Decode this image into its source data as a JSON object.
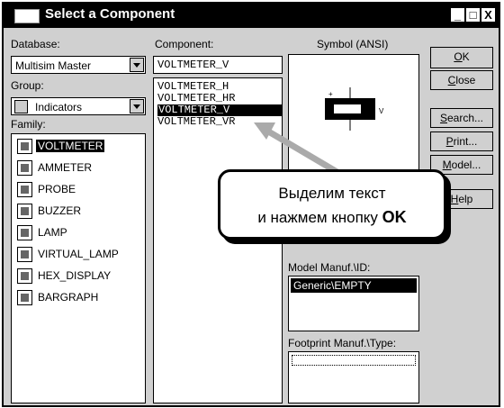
{
  "window": {
    "title": "Select a Component",
    "minimize_glyph": "_",
    "maximize_glyph": "□",
    "close_glyph": "X"
  },
  "database": {
    "label": "Database:",
    "value": "Multisim Master"
  },
  "group": {
    "label": "Group:",
    "value": "Indicators"
  },
  "family": {
    "label": "Family:",
    "items": [
      {
        "label": "VOLTMETER",
        "icon": "voltmeter-icon",
        "selected": true
      },
      {
        "label": "AMMETER",
        "icon": "ammeter-icon"
      },
      {
        "label": "PROBE",
        "icon": "probe-icon"
      },
      {
        "label": "BUZZER",
        "icon": "buzzer-icon"
      },
      {
        "label": "LAMP",
        "icon": "lamp-icon"
      },
      {
        "label": "VIRTUAL_LAMP",
        "icon": "virtual-lamp-icon"
      },
      {
        "label": "HEX_DISPLAY",
        "icon": "hex-display-icon"
      },
      {
        "label": "BARGRAPH",
        "icon": "bargraph-icon"
      }
    ]
  },
  "component": {
    "label": "Component:",
    "value": "VOLTMETER_V",
    "items": [
      "VOLTMETER_H",
      "VOLTMETER_HR",
      "VOLTMETER_V",
      "VOLTMETER_VR"
    ],
    "selected_index": 2
  },
  "symbol": {
    "label": "Symbol (ANSI)",
    "unit_mark": "V"
  },
  "model_manuf": {
    "label": "Model Manuf.\\ID:",
    "items": [
      "Generic\\EMPTY"
    ]
  },
  "footprint": {
    "label": "Footprint Manuf.\\Type:"
  },
  "buttons": {
    "ok": {
      "underlined": "O",
      "rest": "K"
    },
    "close": {
      "underlined": "C",
      "rest": "lose"
    },
    "search": {
      "underlined": "S",
      "rest": "earch..."
    },
    "print": {
      "underlined": "P",
      "rest": "rint..."
    },
    "model": {
      "underlined": "M",
      "rest": "odel..."
    },
    "help": {
      "underlined": "H",
      "rest": "elp"
    }
  },
  "callout": {
    "line1": "Выделим текст",
    "line2_prefix": "и нажмем кнопку ",
    "line2_button": "OK"
  }
}
